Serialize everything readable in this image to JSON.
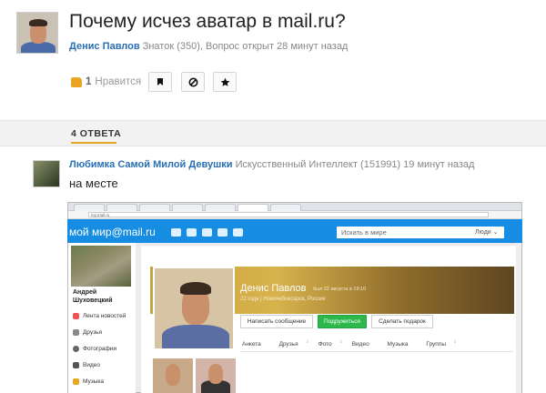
{
  "question": {
    "title": "Почему исчез аватар в mail.ru?",
    "author": "Денис Павлов",
    "author_meta": "Знаток (350), Вопрос открыт 28 минут назад",
    "like_count": "1",
    "like_label": "Нравится"
  },
  "icons": {
    "like": "thumbs-up-icon",
    "bookmark": "bookmark-icon",
    "block": "block-icon",
    "star": "star-icon"
  },
  "answers_tab": "4 ОТВЕТА",
  "answer": {
    "author": "Любимка Самой Милой Девушки",
    "author_meta": "Искусственный Интеллект (151991) 19 минут назад",
    "text": "на месте"
  },
  "screenshot": {
    "address": "my.mail.ru",
    "logo": "мой мир@mail.ru",
    "search_placeholder": "Искать в мире",
    "search_scope": "Люди ⌄",
    "user_name": "Андрей Шуховецкий",
    "menu": [
      "Лента новостей",
      "Друзья",
      "Фотографии",
      "Видео",
      "Музыка"
    ],
    "profile_name": "Денис Павлов",
    "last_seen": "был 22 августа в 19:10",
    "profile_sub": "22 года | Новочебоксарск, Россия",
    "buttons": [
      "Написать сообщение",
      "Подружиться",
      "Сделать подарок"
    ],
    "tabs": [
      "Анкета",
      "Друзья",
      "Фото",
      "Видео",
      "Музыка",
      "Группы"
    ],
    "tab_counts": [
      "",
      "2",
      "2",
      "",
      "",
      "2"
    ]
  },
  "colors": {
    "link": "#2a6fb5",
    "accent": "#e8a522",
    "mailru_blue": "#168de2",
    "green_button": "#2db84c"
  }
}
